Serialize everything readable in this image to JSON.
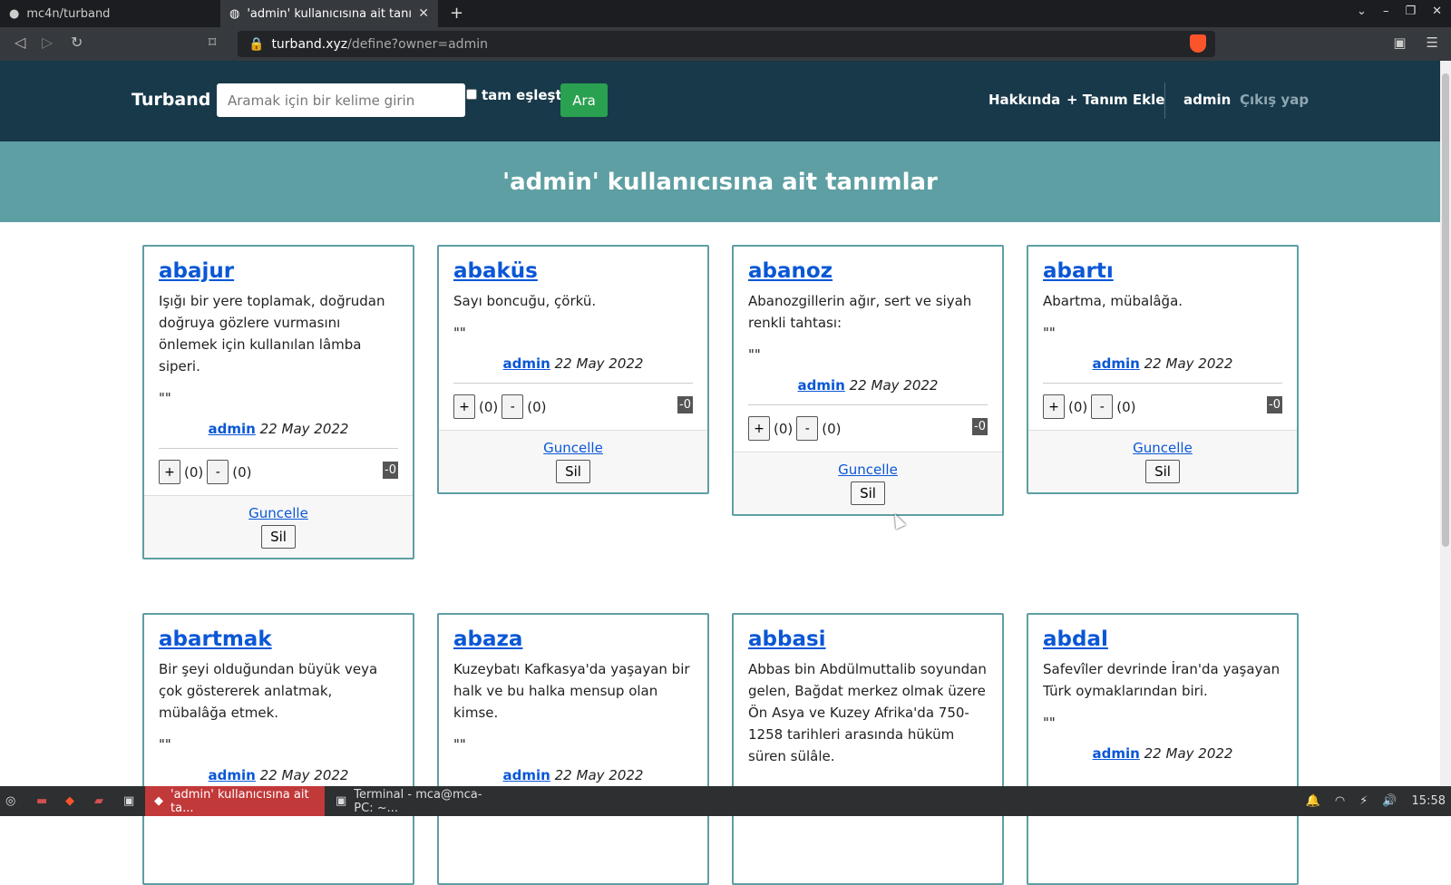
{
  "browser": {
    "tabs": [
      {
        "title": "mc4n/turband",
        "icon": "github-icon"
      },
      {
        "title": "'admin' kullanıcısına ait tanım",
        "icon": "globe-icon"
      }
    ],
    "url_host": "turband.xyz",
    "url_path": "/define?owner=admin"
  },
  "site": {
    "brand": "Turband",
    "search_placeholder": "Aramak için bir kelime girin",
    "exact_match_label": "tam eşleştir",
    "search_button": "Ara",
    "nav": {
      "about": "Hakkında",
      "add_definition": "+ Tanım Ekle",
      "user": "admin",
      "logout": "Çıkış yap"
    },
    "hero_title": "'admin' kullanıcısına ait tanımlar"
  },
  "cards": [
    {
      "word": "abajur",
      "definition": "Işığı bir yere toplamak, doğrudan doğruya gözlere vurmasını önlemek için kullanılan lâmba siperi.",
      "quote": "\"\"",
      "author": "admin",
      "date": "22 May 2022",
      "up": "(0)",
      "down": "(0)",
      "score": "0",
      "update": "Guncelle",
      "delete": "Sil"
    },
    {
      "word": "abaküs",
      "definition": "Sayı boncuğu, çörkü.",
      "quote": "\"\"",
      "author": "admin",
      "date": "22 May 2022",
      "up": "(0)",
      "down": "(0)",
      "score": "0",
      "update": "Guncelle",
      "delete": "Sil"
    },
    {
      "word": "abanoz",
      "definition": "Abanozgillerin ağır, sert ve siyah renkli tahtası:",
      "quote": "\"\"",
      "author": "admin",
      "date": "22 May 2022",
      "up": "(0)",
      "down": "(0)",
      "score": "0",
      "update": "Guncelle",
      "delete": "Sil"
    },
    {
      "word": "abartı",
      "definition": "Abartma, mübalâğa.",
      "quote": "\"\"",
      "author": "admin",
      "date": "22 May 2022",
      "up": "(0)",
      "down": "(0)",
      "score": "0",
      "update": "Guncelle",
      "delete": "Sil"
    },
    {
      "word": "abartmak",
      "definition": "Bir şeyi olduğundan büyük veya çok göstererek anlatmak, mübalâğa etmek.",
      "quote": "\"\"",
      "author": "admin",
      "date": "22 May 2022"
    },
    {
      "word": "abaza",
      "definition": "Kuzeybatı Kafkasya'da yaşayan bir halk ve bu halka mensup olan kimse.",
      "quote": "\"\"",
      "author": "admin",
      "date": "22 May 2022"
    },
    {
      "word": "abbasi",
      "definition": "Abbas bin Abdülmuttalib soyundan gelen, Bağdat merkez olmak üzere Ön Asya ve Kuzey Afrika'da 750-1258 tarihleri arasında hüküm süren sülâle."
    },
    {
      "word": "abdal",
      "definition": "Safevîler devrinde İran'da yaşayan Türk oymaklarından biri.",
      "quote": "\"\"",
      "author": "admin",
      "date": "22 May 2022"
    }
  ],
  "taskbar": {
    "tasks": [
      "'admin' kullanıcısına ait ta...",
      "Terminal - mca@mca-PC: ~..."
    ],
    "clock": "15:58"
  }
}
